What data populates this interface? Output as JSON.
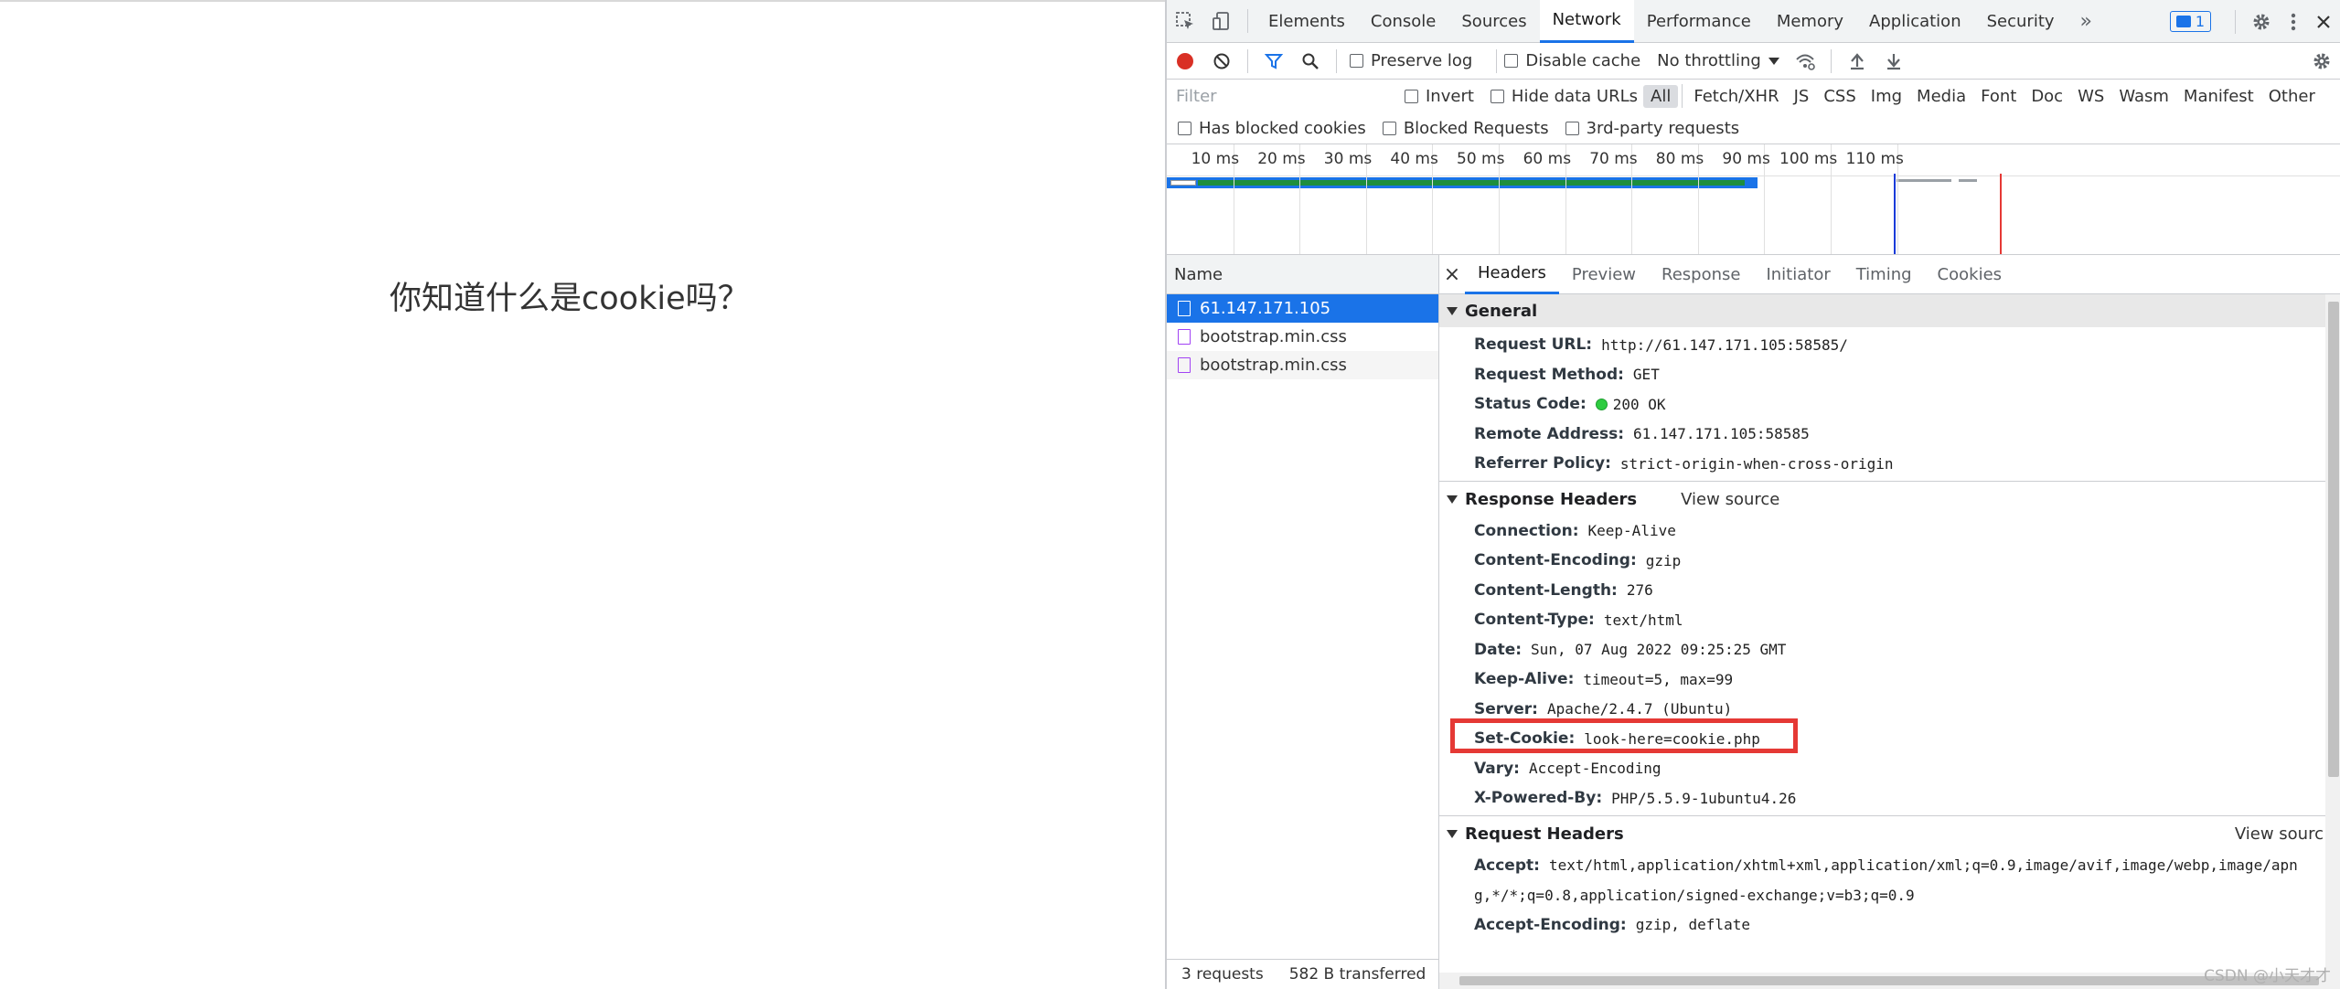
{
  "page": {
    "heading": "你知道什么是cookie吗？"
  },
  "devtools": {
    "tabs": [
      "Elements",
      "Console",
      "Sources",
      "Network",
      "Performance",
      "Memory",
      "Application",
      "Security"
    ],
    "active_tab": "Network",
    "more_tabs_label": "»",
    "issues_count": "1",
    "toolbar": {
      "preserve_log": "Preserve log",
      "disable_cache": "Disable cache",
      "throttling": "No throttling"
    },
    "filter": {
      "placeholder": "Filter",
      "invert": "Invert",
      "hide_data_urls": "Hide data URLs",
      "types": [
        "All",
        "Fetch/XHR",
        "JS",
        "CSS",
        "Img",
        "Media",
        "Font",
        "Doc",
        "WS",
        "Wasm",
        "Manifest",
        "Other"
      ],
      "active_type": "All",
      "has_blocked_cookies": "Has blocked cookies",
      "blocked_requests": "Blocked Requests",
      "third_party": "3rd-party requests"
    },
    "timeline": {
      "ticks": [
        "10 ms",
        "20 ms",
        "30 ms",
        "40 ms",
        "50 ms",
        "60 ms",
        "70 ms",
        "80 ms",
        "90 ms",
        "100 ms",
        "110 ms"
      ],
      "colors": {
        "dom_content_loaded": "#1a3bd9",
        "load": "#e53935",
        "bar_blue": "#1a73e8",
        "bar_green": "#1e8e3e"
      }
    },
    "requests": {
      "header": "Name",
      "items": [
        {
          "name": "61.147.171.105",
          "type": "document"
        },
        {
          "name": "bootstrap.min.css",
          "type": "stylesheet"
        },
        {
          "name": "bootstrap.min.css",
          "type": "stylesheet"
        }
      ],
      "status": {
        "count": "3 requests",
        "transferred": "582 B transferred"
      }
    },
    "detail": {
      "tabs": [
        "Headers",
        "Preview",
        "Response",
        "Initiator",
        "Timing",
        "Cookies"
      ],
      "active_tab": "Headers",
      "general": {
        "title": "General",
        "fields": [
          {
            "key": "Request URL:",
            "value": "http://61.147.171.105:58585/"
          },
          {
            "key": "Request Method:",
            "value": "GET"
          },
          {
            "key": "Status Code:",
            "value": "200 OK"
          },
          {
            "key": "Remote Address:",
            "value": "61.147.171.105:58585"
          },
          {
            "key": "Referrer Policy:",
            "value": "strict-origin-when-cross-origin"
          }
        ]
      },
      "response_headers": {
        "title": "Response Headers",
        "view_source": "View source",
        "fields": [
          {
            "key": "Connection:",
            "value": "Keep-Alive"
          },
          {
            "key": "Content-Encoding:",
            "value": "gzip"
          },
          {
            "key": "Content-Length:",
            "value": "276"
          },
          {
            "key": "Content-Type:",
            "value": "text/html"
          },
          {
            "key": "Date:",
            "value": "Sun, 07 Aug 2022 09:25:25 GMT"
          },
          {
            "key": "Keep-Alive:",
            "value": "timeout=5, max=99"
          },
          {
            "key": "Server:",
            "value": "Apache/2.4.7 (Ubuntu)"
          },
          {
            "key": "Set-Cookie:",
            "value": "look-here=cookie.php"
          },
          {
            "key": "Vary:",
            "value": "Accept-Encoding"
          },
          {
            "key": "X-Powered-By:",
            "value": "PHP/5.5.9-1ubuntu4.26"
          }
        ]
      },
      "request_headers": {
        "title": "Request Headers",
        "view_source": "View sourc",
        "fields": [
          {
            "key": "Accept:",
            "value": "text/html,application/xhtml+xml,application/xml;q=0.9,image/avif,image/webp,image/apn"
          },
          {
            "key": "",
            "value": "g,*/*;q=0.8,application/signed-exchange;v=b3;q=0.9"
          },
          {
            "key": "Accept-Encoding:",
            "value": "gzip, deflate"
          }
        ]
      },
      "highlight_color": "#e53935"
    }
  },
  "watermark": "CSDN @小天才才"
}
